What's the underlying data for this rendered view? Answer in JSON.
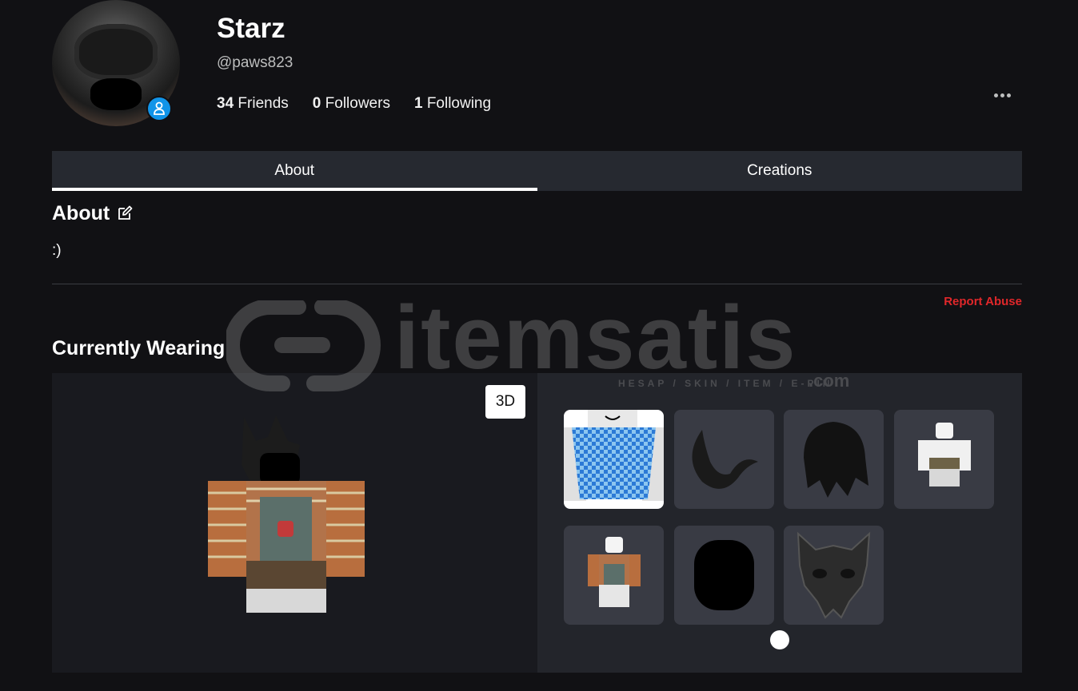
{
  "profile": {
    "display_name": "Starz",
    "username": "@paws823",
    "stats": [
      {
        "count": "34",
        "label": "Friends"
      },
      {
        "count": "0",
        "label": "Followers"
      },
      {
        "count": "1",
        "label": "Following"
      }
    ]
  },
  "tabs": [
    {
      "label": "About",
      "active": true
    },
    {
      "label": "Creations",
      "active": false
    }
  ],
  "about": {
    "title": "About",
    "text": ":)",
    "report_label": "Report Abuse"
  },
  "wearing": {
    "title": "Currently Wearing",
    "view_toggle_label": "3D",
    "items": [
      {
        "icon": "checkered-shirt-thumbnail"
      },
      {
        "icon": "black-tail-thumbnail"
      },
      {
        "icon": "black-hair-thumbnail"
      },
      {
        "icon": "white-avatar-outfit-thumbnail"
      },
      {
        "icon": "sweater-overalls-outfit-thumbnail"
      },
      {
        "icon": "black-head-thumbnail"
      },
      {
        "icon": "wolf-mask-thumbnail"
      }
    ],
    "page_indicator_count": 1
  },
  "watermark": {
    "brand": "itemsatis",
    "tagline": "HESAP / SKIN / ITEM / E-PIN",
    "suffix": ".com"
  },
  "colors": {
    "background": "#111114",
    "tab_bar": "#262930",
    "report": "#e0272a",
    "presence": "#1194e8"
  }
}
